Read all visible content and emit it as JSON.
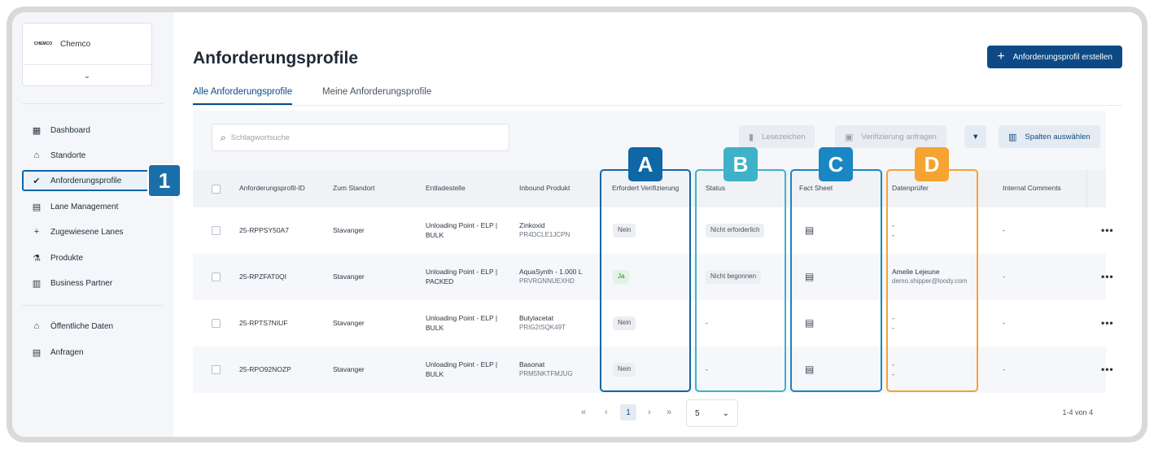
{
  "company": {
    "logo_text": "CHEMCO",
    "name": "Chemco",
    "toggle": "⌄"
  },
  "nav": [
    {
      "label": "Dashboard",
      "icon": "▦"
    },
    {
      "label": "Standorte",
      "icon": "⌂"
    },
    {
      "label": "Anforderungsprofile",
      "icon": "✔"
    },
    {
      "label": "Lane Management",
      "icon": "▤"
    },
    {
      "label": "Zugewiesene Lanes",
      "icon": "+"
    },
    {
      "label": "Produkte",
      "icon": "⚗"
    },
    {
      "label": "Business Partner",
      "icon": "▥"
    }
  ],
  "nav2": [
    {
      "label": "Öffentliche Daten",
      "icon": "⌂"
    },
    {
      "label": "Anfragen",
      "icon": "▤"
    }
  ],
  "callout_1": "1",
  "page": {
    "title": "Anforderungsprofile",
    "create_label": "Anforderungsprofil erstellen",
    "create_icon": "+",
    "tabs": [
      "Alle Anforderungsprofile",
      "Meine Anforderungsprofile"
    ]
  },
  "toolbar": {
    "search_placeholder": "Schlagwortsuche",
    "search_icon": "⌕",
    "bookmark_label": "Lesezeichen",
    "verify_label": "Verifizierung anfragen",
    "columns_label": "Spalten auswählen",
    "filter_icon": "▼"
  },
  "columns": [
    "Anforderungsprofil-ID",
    "Zum Standort",
    "Entladestelle",
    "Inbound Produkt",
    "Erfordert Verifizierung",
    "Status",
    "Fact Sheet",
    "Datenprüfer",
    "Internal Comments"
  ],
  "rows": [
    {
      "id": "25-RPPSY50A7",
      "site": "Stavanger",
      "unload": "Unloading Point - ELP |",
      "unload2": "BULK",
      "product": "Zinkoxid",
      "product_code": "PR4DCLE1JCPN",
      "verify": "Nein",
      "status": "Nicht erforderlich",
      "checker1": "-",
      "checker2": "-",
      "comments": "-",
      "more": "•••"
    },
    {
      "id": "25-RPZFAT0QI",
      "site": "Stavanger",
      "unload": "Unloading Point - ELP |",
      "unload2": "PACKED",
      "product": "AquaSynth - 1.000 L",
      "product_code": "PRVRGNNUEXHD",
      "verify": "Ja",
      "status": "Nicht begonnen",
      "checker1": "Amelie Lejeune",
      "checker2": "demo.shipper@loody.com",
      "comments": "-",
      "more": "•••"
    },
    {
      "id": "25-RPTS7NIUF",
      "site": "Stavanger",
      "unload": "Unloading Point - ELP |",
      "unload2": "BULK",
      "product": "Butylacetat",
      "product_code": "PRIG2ISQK49T",
      "verify": "Nein",
      "status": "-",
      "checker1": "-",
      "checker2": "-",
      "comments": "-",
      "more": "•••"
    },
    {
      "id": "25-RPO92NOZP",
      "site": "Stavanger",
      "unload": "Unloading Point - ELP |",
      "unload2": "BULK",
      "product": "Basonat",
      "product_code": "PRM5NKTFMJUG",
      "verify": "Nein",
      "status": "-",
      "checker1": "-",
      "checker2": "-",
      "comments": "-",
      "more": "•••"
    }
  ],
  "callouts": [
    "A",
    "B",
    "C",
    "D"
  ],
  "callout_colors": {
    "A": "#0f67a6",
    "B": "#3fb2c9",
    "C": "#1a86c2",
    "D": "#f5a331"
  },
  "pagination": {
    "first": "«",
    "prev": "‹",
    "current": "1",
    "next": "›",
    "last": "»",
    "page_size": "5",
    "range": "1-4 von 4"
  }
}
